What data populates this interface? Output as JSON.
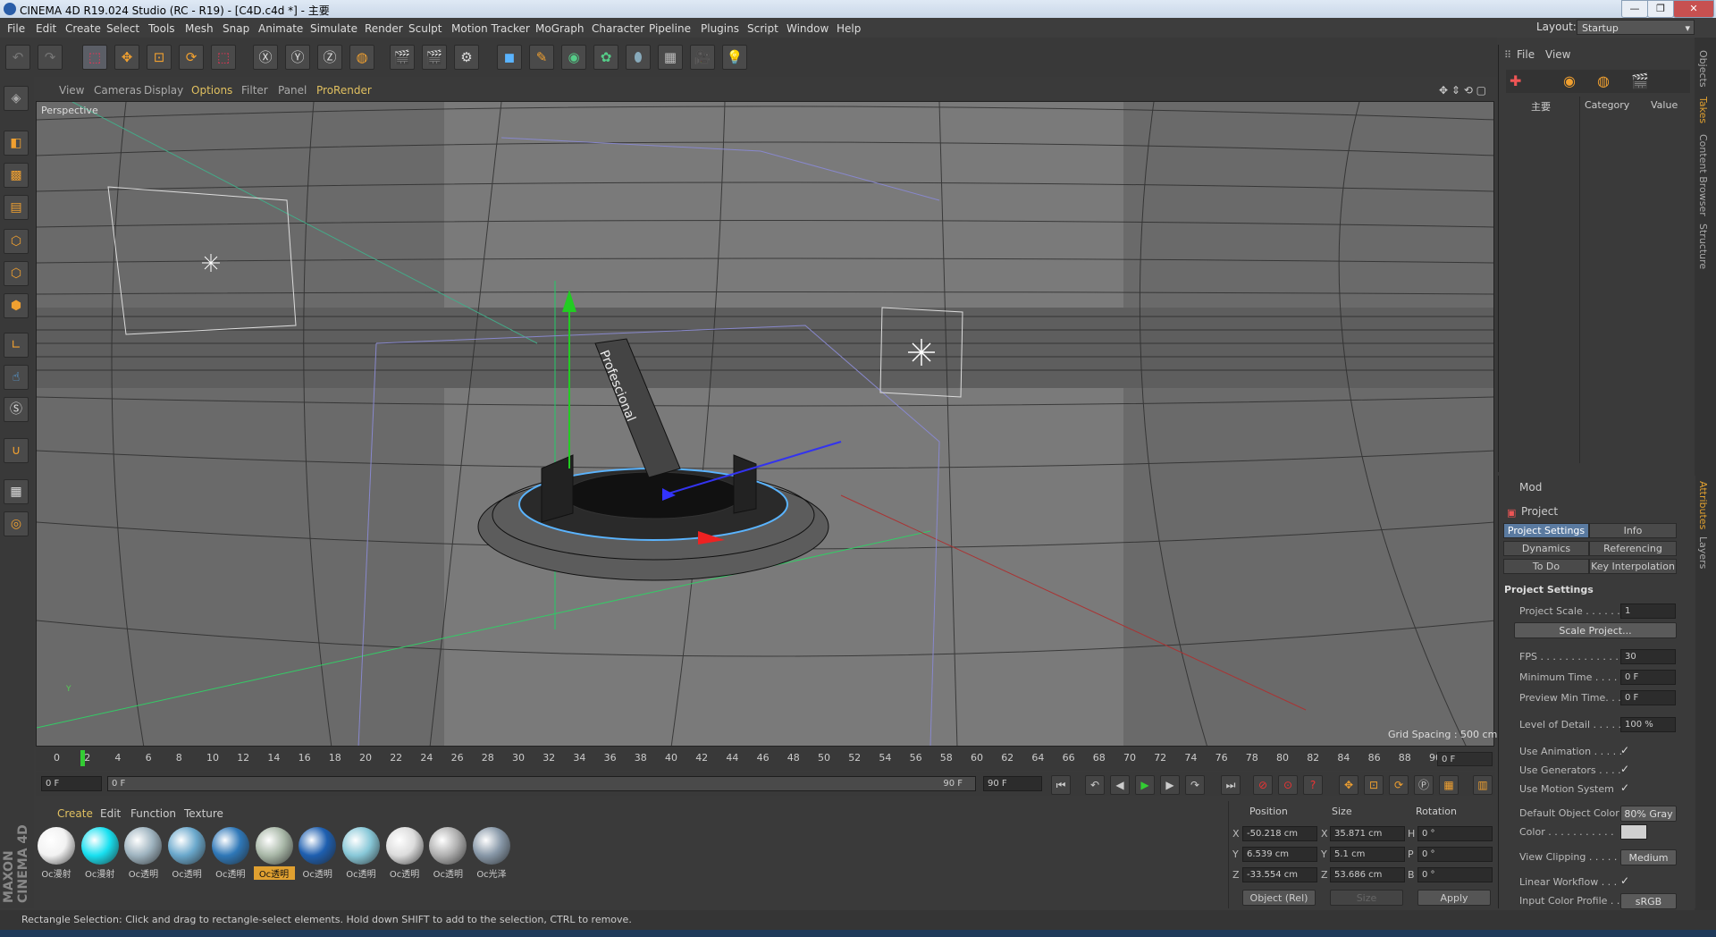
{
  "window": {
    "title": "CINEMA 4D R19.024 Studio (RC - R19) - [C4D.c4d *] - 主要"
  },
  "menubar": {
    "items": [
      "File",
      "Edit",
      "Create",
      "Select",
      "Tools",
      "Mesh",
      "Snap",
      "Animate",
      "Simulate",
      "Render",
      "Sculpt",
      "Motion Tracker",
      "MoGraph",
      "Character",
      "Pipeline",
      "Plugins",
      "Script",
      "Window",
      "Help"
    ],
    "layout_label": "Layout:",
    "layout_value": "Startup"
  },
  "viewport": {
    "menu": [
      "View",
      "Cameras",
      "Display",
      "Options",
      "Filter",
      "Panel",
      "ProRender"
    ],
    "camera_label": "Perspective",
    "grid_spacing": "Grid Spacing : 500 cm",
    "object_label": "Profescional"
  },
  "timeline": {
    "ticks": [
      "0",
      "2",
      "4",
      "6",
      "8",
      "10",
      "12",
      "14",
      "16",
      "18",
      "20",
      "22",
      "24",
      "26",
      "28",
      "30",
      "32",
      "34",
      "36",
      "38",
      "40",
      "42",
      "44",
      "46",
      "48",
      "50",
      "52",
      "54",
      "56",
      "58",
      "60",
      "62",
      "64",
      "66",
      "68",
      "70",
      "72",
      "74",
      "76",
      "78",
      "80",
      "82",
      "84",
      "86",
      "88",
      "90"
    ],
    "current_frame": "0 F",
    "start_field": "0 F",
    "range_start": "0 F",
    "range_end": "90 F",
    "end_field": "90 F"
  },
  "materials": {
    "tabs": [
      "Create",
      "Edit",
      "Function",
      "Texture"
    ],
    "items": [
      {
        "label": "Oc漫射",
        "color": "#f2f2f2"
      },
      {
        "label": "Oc漫射",
        "color": "#18e0f0"
      },
      {
        "label": "Oc透明",
        "color": "#9fb4c0"
      },
      {
        "label": "Oc透明",
        "color": "#6aa8cc"
      },
      {
        "label": "Oc透明",
        "color": "#2f78b8"
      },
      {
        "label": "Oc透明",
        "color": "#a9b8a8"
      },
      {
        "label": "Oc透明",
        "color": "#1e5fb0"
      },
      {
        "label": "Oc透明",
        "color": "#88c8d8"
      },
      {
        "label": "Oc透明",
        "color": "#dcdcdc"
      },
      {
        "label": "Oc透明",
        "color": "#b0b0b0"
      },
      {
        "label": "Oc光泽",
        "color": "#8898a8"
      }
    ]
  },
  "coords": {
    "headers": [
      "Position",
      "Size",
      "Rotation"
    ],
    "pos": {
      "x": "-50.218 cm",
      "y": "6.539 cm",
      "z": "-33.554 cm"
    },
    "size": {
      "x": "35.871 cm",
      "y": "5.1 cm",
      "z": "53.686 cm"
    },
    "rot": {
      "h": "0 °",
      "p": "0 °",
      "b": "0 °"
    },
    "labels": {
      "x": "X",
      "y": "Y",
      "z": "Z",
      "h": "H",
      "p": "P",
      "b": "B"
    },
    "mode": "Object (Rel)",
    "size_mode": "Size",
    "apply": "Apply"
  },
  "objects_panel": {
    "menu": [
      "File",
      "View"
    ],
    "layer_name": "主要",
    "columns": [
      "Category",
      "Value"
    ]
  },
  "right_tabs": [
    "Objects",
    "Takes",
    "Content Browser",
    "Structure",
    "Attributes",
    "Layers"
  ],
  "attributes": {
    "mode": "Mod",
    "title": "Project",
    "tabs": [
      "Project Settings",
      "Info",
      "Dynamics",
      "Referencing",
      "To Do",
      "Key Interpolation"
    ],
    "section": "Project Settings",
    "rows": {
      "project_scale": "Project Scale . . . . . .",
      "project_scale_val": "1",
      "scale_project": "Scale Project...",
      "fps": "FPS . . . . . . . . . . . . . .",
      "fps_val": "30",
      "min_time": "Minimum Time . . . .",
      "min_time_val": "0 F",
      "preview_min": "Preview Min Time. . .",
      "preview_min_val": "0 F",
      "lod": "Level of Detail . . . . .",
      "lod_val": "100 %",
      "use_anim": "Use Animation . . . . .",
      "use_gen": "Use Generators . . . .",
      "use_motion": "Use Motion System",
      "def_color": "Default Object Color",
      "def_color_val": "80% Gray",
      "color": "Color . . . . . . . . . . .",
      "view_clip": "View Clipping . . . . .",
      "view_clip_val": "Medium",
      "linear": "Linear Workflow . . .",
      "icp": "Input Color Profile . . .",
      "icp_val": "sRGB",
      "check": "✓"
    }
  },
  "status": {
    "text": "Rectangle Selection: Click and drag to rectangle-select elements. Hold down SHIFT to add to the selection, CTRL to remove."
  },
  "brand": "MAXON CINEMA 4D"
}
